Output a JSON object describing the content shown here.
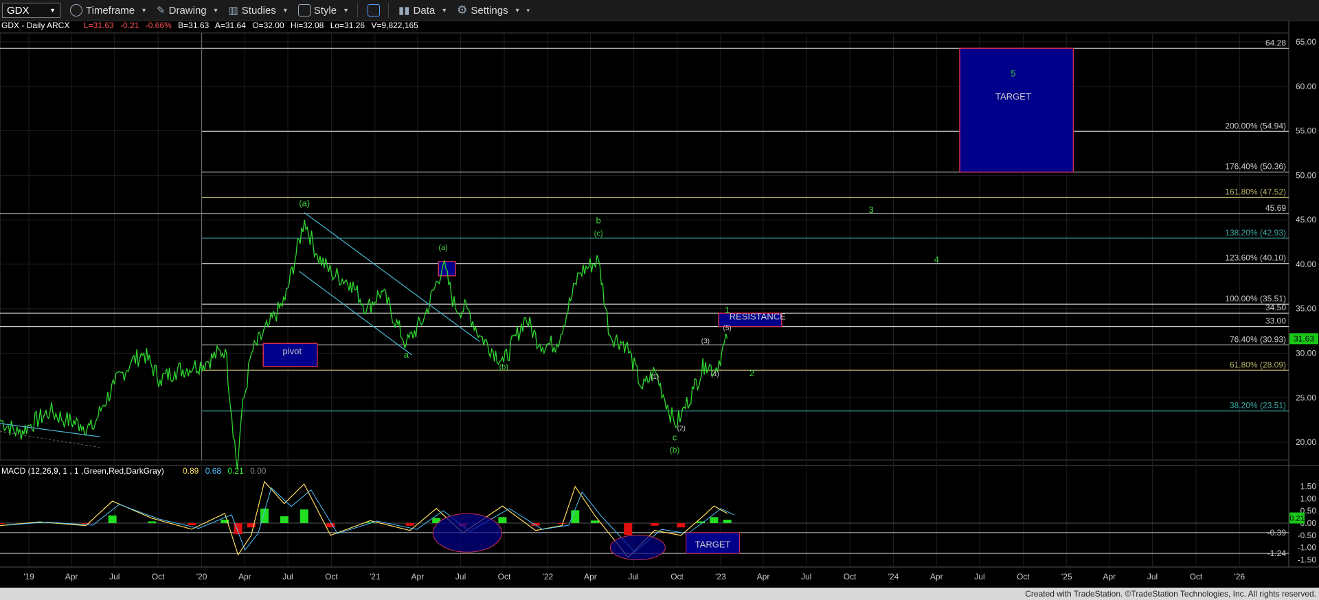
{
  "toolbar": {
    "symbol": "GDX",
    "items": [
      "Timeframe",
      "Drawing",
      "Studies",
      "Style",
      "Data",
      "Settings"
    ]
  },
  "chart_data": {
    "type": "line",
    "title": "GDX - Daily  ARCX",
    "quote": {
      "L": "L=31.63",
      "chg": "-0.21",
      "pct": "-0.66%",
      "B": "B=31.63",
      "A": "A=31.64",
      "O": "O=32.00",
      "Hi": "Hi=32.08",
      "Lo": "Lo=31.26",
      "V": "V=9,822,165"
    },
    "y_ticks": [
      "65.00",
      "60.00",
      "55.00",
      "50.00",
      "45.00",
      "40.00",
      "35.00",
      "30.00",
      "25.00",
      "20.00"
    ],
    "ylim": [
      18,
      66
    ],
    "x_ticks": [
      "'19",
      "Apr",
      "Jul",
      "Oct",
      "'20",
      "Apr",
      "Jul",
      "Oct",
      "'21",
      "Apr",
      "Jul",
      "Oct",
      "'22",
      "Apr",
      "Jul",
      "Oct",
      "'23",
      "Apr",
      "Jul",
      "Oct",
      "'24",
      "Apr",
      "Jul",
      "Oct",
      "'25",
      "Apr",
      "Jul",
      "Oct",
      "'26"
    ],
    "x_range": [
      "2018-11-01",
      "2026-04-15"
    ],
    "last_price": "31.63",
    "price_path": [
      [
        "2018-11-01",
        22.5
      ],
      [
        "2018-12-10",
        21
      ],
      [
        "2019-01-05",
        22
      ],
      [
        "2019-02-15",
        23.5
      ],
      [
        "2019-03-20",
        22.5
      ],
      [
        "2019-04-20",
        22
      ],
      [
        "2019-05-15",
        21.5
      ],
      [
        "2019-06-05",
        24
      ],
      [
        "2019-07-01",
        26.5
      ],
      [
        "2019-08-05",
        29
      ],
      [
        "2019-09-01",
        30
      ],
      [
        "2019-10-05",
        27
      ],
      [
        "2019-11-05",
        28
      ],
      [
        "2019-12-15",
        28.5
      ],
      [
        "2020-01-10",
        29
      ],
      [
        "2020-02-20",
        30.5
      ],
      [
        "2020-03-16",
        17
      ],
      [
        "2020-03-25",
        23
      ],
      [
        "2020-04-15",
        30
      ],
      [
        "2020-05-20",
        33
      ],
      [
        "2020-06-25",
        36
      ],
      [
        "2020-08-05",
        45
      ],
      [
        "2020-09-01",
        41
      ],
      [
        "2020-10-01",
        39
      ],
      [
        "2020-11-10",
        38
      ],
      [
        "2020-12-15",
        35
      ],
      [
        "2021-01-15",
        37
      ],
      [
        "2021-03-08",
        31
      ],
      [
        "2021-04-15",
        34
      ],
      [
        "2021-05-25",
        40
      ],
      [
        "2021-06-20",
        35
      ],
      [
        "2021-07-15",
        35
      ],
      [
        "2021-08-10",
        32
      ],
      [
        "2021-09-30",
        29
      ],
      [
        "2021-11-15",
        34
      ],
      [
        "2021-12-15",
        31
      ],
      [
        "2022-01-20",
        31
      ],
      [
        "2022-03-08",
        39
      ],
      [
        "2022-04-18",
        40.5
      ],
      [
        "2022-05-12",
        32
      ],
      [
        "2022-06-15",
        31
      ],
      [
        "2022-07-20",
        26
      ],
      [
        "2022-08-15",
        28
      ],
      [
        "2022-09-26",
        22
      ],
      [
        "2022-10-10",
        23
      ],
      [
        "2022-11-05",
        26
      ],
      [
        "2022-11-30",
        29
      ],
      [
        "2022-12-20",
        28
      ],
      [
        "2023-01-15",
        31.63
      ]
    ],
    "levels": [
      {
        "label": "64.28",
        "value": 64.28
      },
      {
        "label": "200.00% (54.94)",
        "value": 54.94
      },
      {
        "label": "176.40% (50.36)",
        "value": 50.36
      },
      {
        "label": "161.80% (47.52)",
        "value": 47.52
      },
      {
        "label": "45.69",
        "value": 45.69
      },
      {
        "label": "138.20% (42.93)",
        "value": 42.93
      },
      {
        "label": "123.60% (40.10)",
        "value": 40.1
      },
      {
        "label": "100.00% (35.51)",
        "value": 35.51
      },
      {
        "label": "34.50",
        "value": 34.5
      },
      {
        "label": "33.00",
        "value": 33.0
      },
      {
        "label": "76.40% (30.93)",
        "value": 30.93
      },
      {
        "label": "61.80% (28.09)",
        "value": 28.09
      },
      {
        "label": "38.20% (23.51)",
        "value": 23.51
      }
    ],
    "annotations": [
      {
        "text": "(a)",
        "date": "2020-08-05",
        "value": 46.5,
        "color": "#3fd23f",
        "size": 13
      },
      {
        "text": "a",
        "date": "2021-03-08",
        "value": 29.5,
        "color": "#3fd23f",
        "size": 13
      },
      {
        "text": "(a)",
        "date": "2021-05-25",
        "value": 41.6,
        "color": "#3fd23f",
        "size": 11
      },
      {
        "text": "(b)",
        "date": "2021-09-30",
        "value": 28.2,
        "color": "#3fd23f",
        "size": 11
      },
      {
        "text": "b",
        "date": "2022-04-18",
        "value": 44.6,
        "color": "#3fd23f",
        "size": 13
      },
      {
        "text": "(c)",
        "date": "2022-04-18",
        "value": 43.2,
        "color": "#3fd23f",
        "size": 11
      },
      {
        "text": "(1)",
        "date": "2022-08-15",
        "value": 27.1,
        "color": "#ccc",
        "size": 10
      },
      {
        "text": "(2)",
        "date": "2022-10-10",
        "value": 21.3,
        "color": "#ccc",
        "size": 10
      },
      {
        "text": "c",
        "date": "2022-09-26",
        "value": 20.2,
        "color": "#3fd23f",
        "size": 13
      },
      {
        "text": "(b)",
        "date": "2022-09-26",
        "value": 18.8,
        "color": "#3fd23f",
        "size": 12
      },
      {
        "text": "(3)",
        "date": "2022-11-30",
        "value": 31.1,
        "color": "#ccc",
        "size": 10
      },
      {
        "text": "(4)",
        "date": "2022-12-20",
        "value": 27.4,
        "color": "#ccc",
        "size": 10
      },
      {
        "text": "(5)",
        "date": "2023-01-15",
        "value": 32.6,
        "color": "#ccc",
        "size": 10
      },
      {
        "text": "1",
        "date": "2023-01-15",
        "value": 34.5,
        "color": "#3fd23f",
        "size": 13
      },
      {
        "text": "2",
        "date": "2023-03-08",
        "value": 27.4,
        "color": "#3fd23f",
        "size": 13
      },
      {
        "text": "3",
        "date": "2023-11-15",
        "value": 45.8,
        "color": "#3fd23f",
        "size": 13
      },
      {
        "text": "4",
        "date": "2024-04-01",
        "value": 40.2,
        "color": "#3fd23f",
        "size": 13
      },
      {
        "text": "5",
        "date": "2024-09-10",
        "value": 61.1,
        "color": "#3fd23f",
        "size": 13
      },
      {
        "text": "TARGET",
        "date": "2024-09-10",
        "value": 58.5,
        "color": "#ccc",
        "size": 13
      },
      {
        "text": "RESISTANCE",
        "date": "2023-03-20",
        "value": 33.8,
        "color": "#ccc",
        "size": 13
      },
      {
        "text": "pivot",
        "date": "2020-07-10",
        "value": 29.9,
        "color": "#ccc",
        "size": 13
      }
    ],
    "boxes": [
      {
        "name": "target-box",
        "x0": "2024-05-20",
        "x1": "2025-01-15",
        "y0": 50.36,
        "y1": 64.28
      },
      {
        "name": "resistance-box",
        "x0": "2022-12-28",
        "x1": "2023-05-10",
        "y0": 33.0,
        "y1": 34.5
      },
      {
        "name": "pivot-box",
        "x0": "2020-05-10",
        "x1": "2020-09-01",
        "y0": 28.5,
        "y1": 31.1
      },
      {
        "name": "small-box",
        "x0": "2021-05-15",
        "x1": "2021-06-20",
        "y0": 38.7,
        "y1": 40.3
      }
    ],
    "macd": {
      "label": "MACD (12,26,9, 1 , 1 ,Green,Red,DarkGray)",
      "values": [
        "0.89",
        "0.68",
        "0.21",
        "0.00"
      ],
      "y_ticks": [
        "1.50",
        "1.00",
        "0.50",
        "0.00",
        "-0.50",
        "-1.00",
        "-1.50"
      ],
      "ylim": [
        -1.8,
        1.8
      ],
      "current": "0.21",
      "extra_levels": [
        {
          "label": "-0.39",
          "value": -0.39
        },
        {
          "label": "-1.24",
          "value": -1.24
        }
      ],
      "target_label": "TARGET"
    },
    "footer": "Created with TradeStation. ©TradeStation Technologies, Inc. All rights reserved."
  }
}
